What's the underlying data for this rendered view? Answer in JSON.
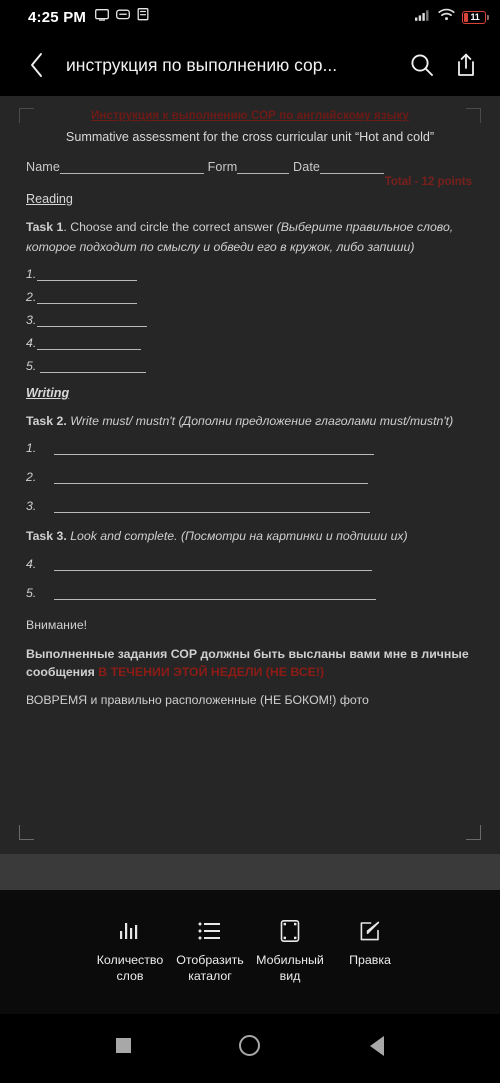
{
  "status_bar": {
    "clock": "4:25 PM",
    "icons": [
      "screen-cast-icon",
      "message-icon",
      "document-icon",
      "signal-icon",
      "wifi-icon"
    ],
    "battery_level": "11"
  },
  "app_bar": {
    "back_icon": "chevron-left-icon",
    "title": "инструкция по выполнению сор...",
    "search_icon": "search-icon",
    "share_icon": "share-icon"
  },
  "document": {
    "red_title": "Инструкция к выполнению СОР по английскому языку",
    "subtitle": "Summative assessment for the cross curricular unit “Hot and cold”",
    "name_label": "Name",
    "form_label": "Form",
    "date_label": "Date",
    "mark_note": "Total - 12 points",
    "reading_heading": "Reading",
    "task1": {
      "label": "Task 1",
      "english": ". Choose and circle the correct answer ",
      "russian": "(Выберите правильное слово, которое подходит по смыслу и обведи его в кружок, либо запиши)",
      "answers": [
        "1.",
        "2.",
        "3.",
        "4.",
        "5."
      ]
    },
    "writing_heading": "Writing",
    "task2": {
      "label": "Task 2.",
      "text": " Write must/ mustn't (Дополни предложение глаголами must/mustn't)",
      "answers": [
        "1.",
        "2.",
        "3."
      ]
    },
    "task3": {
      "label": "Task 3.",
      "text": " Look and complete. (Посмотри на картинки и подпиши их)",
      "answers": [
        "4.",
        "5."
      ]
    },
    "attention_heading": "Внимание!",
    "notice_line1_a": "Выполненные задания СОР должны быть высланы вами мне в личные сообщения ",
    "notice_line1_red": "В ТЕЧЕНИИ ЭТОЙ НЕДЕЛИ (НЕ ВСЕ!)",
    "notice_line2": "ВОВРЕМЯ и правильно расположенные (НЕ БОКОМ!) фото"
  },
  "toolbar": {
    "items": [
      {
        "icon": "word-count-icon",
        "label": "Количество слов"
      },
      {
        "icon": "list-catalog-icon",
        "label": "Отобразить каталог"
      },
      {
        "icon": "mobile-view-icon",
        "label": "Мобильный вид"
      },
      {
        "icon": "edit-pencil-icon",
        "label": "Правка"
      }
    ]
  },
  "nav_bar": {
    "recents_icon": "square-recents-icon",
    "home_icon": "circle-home-icon",
    "back_icon": "triangle-back-icon"
  }
}
